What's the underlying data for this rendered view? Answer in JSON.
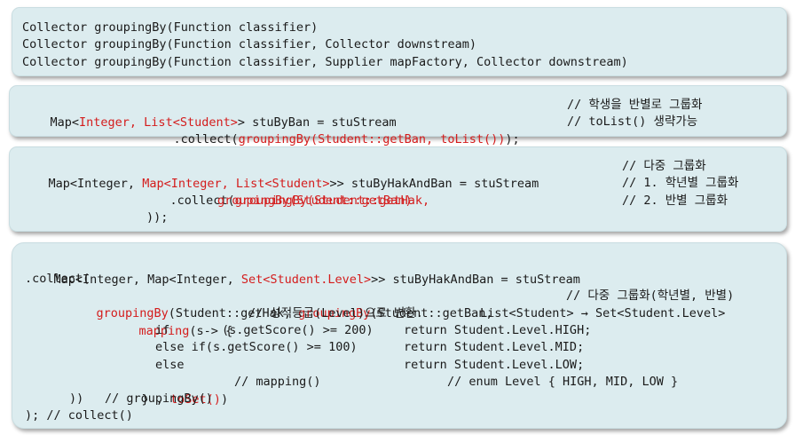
{
  "box1": {
    "lines": [
      "Collector groupingBy(Function classifier)",
      "Collector groupingBy(Function classifier, Collector downstream)",
      "Collector groupingBy(Function classifier, Supplier mapFactory, Collector downstream)"
    ]
  },
  "box2": {
    "l1": {
      "a": "Map<",
      "b": "Integer, List<Student>",
      "c": "> stuByBan = stuStream",
      "comment": "// 학생을 반별로 그룹화"
    },
    "l2": {
      "a": ".collect(",
      "b": "groupingBy(Student::getBan, toList())",
      "c": ");",
      "comment": "// toList() 생략가능"
    }
  },
  "box3": {
    "l1": {
      "a": "Map<Integer, ",
      "b": "Map<Integer, List<Student>",
      "c": ">> stuByHakAndBan = stuStream",
      "comment": "// 다중 그룹화"
    },
    "l2": {
      "a": ".collect(",
      "b": "groupingBy(Student::getHak,",
      "comment": "// 1. 학년별 그룹화"
    },
    "l3": {
      "b": "groupingBy(Student::getBan)",
      "comment": "// 2. 반별 그룹화"
    },
    "l4": {
      "a": "));"
    }
  },
  "box4": {
    "l1": {
      "a": "Map<Integer, Map<Integer, ",
      "b": "Set<Student.Level>",
      "c": ">> stuByHakAndBan = stuStream"
    },
    "l2": {
      "a": ".collect("
    },
    "l3": {
      "b1": "groupingBy",
      "a1": "(Student::getHak, ",
      "b2": "groupingBy",
      "a2": "(Student::getBan,",
      "comment": "// 다중 그룹화(학년별, 반별)"
    },
    "l4": {
      "b": "mapping",
      "a": "(s-> {",
      "comment": "// 성적등급(Level)으로 변환.",
      "note": "List<Student> → Set<Student.Level>"
    },
    "l5": {
      "a": "if",
      "cond": "(s.getScore() >= 200)",
      "ret": "return Student.Level.HIGH;"
    },
    "l6": {
      "a": "else if(s.getScore() >= 100)",
      "ret": "return Student.Level.MID;"
    },
    "l7": {
      "a": "else",
      "ret": "return Student.Level.LOW;"
    },
    "l8": {
      "a": "} , ",
      "b": "toSet()",
      "c": ")",
      "comment": "// mapping()",
      "enum": "// enum Level { HIGH, MID, LOW }"
    },
    "l9": {
      "a": "))",
      "comment": "// groupingBy()"
    },
    "l10": {
      "a": "); // collect()"
    }
  }
}
